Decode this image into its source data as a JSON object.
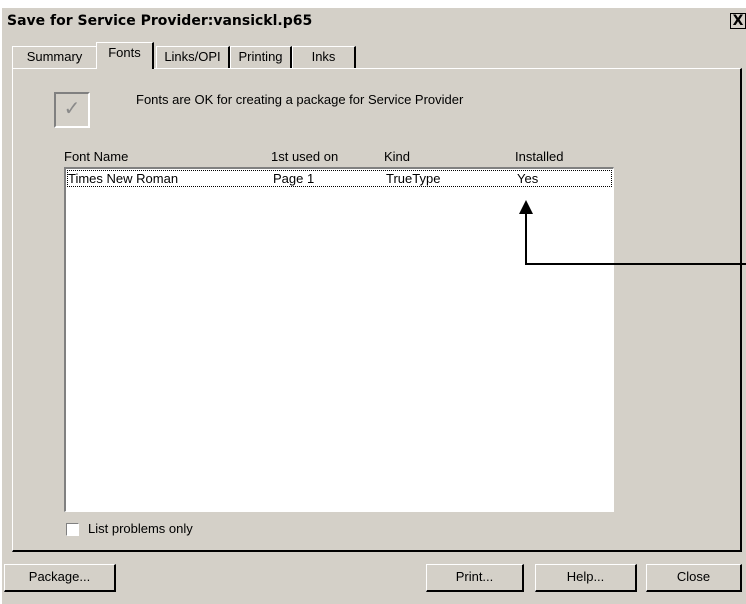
{
  "window": {
    "title": "Save for Service Provider:vansickl.p65",
    "close_label": "X"
  },
  "tabs": [
    {
      "label": "Summary",
      "active": false
    },
    {
      "label": "Fonts",
      "active": true
    },
    {
      "label": "Links/OPI",
      "active": false
    },
    {
      "label": "Printing",
      "active": false
    },
    {
      "label": "Inks",
      "active": false
    }
  ],
  "status": {
    "message": "Fonts are OK for creating a package for Service Provider",
    "checked": true
  },
  "font_table": {
    "columns": [
      "Font Name",
      "1st used on",
      "Kind",
      "Installed"
    ],
    "rows": [
      [
        "Times New Roman",
        "Page 1",
        "TrueType",
        "Yes"
      ]
    ]
  },
  "options": {
    "list_problems_only_label": "List problems only",
    "list_problems_only_checked": false
  },
  "buttons": {
    "package": "Package...",
    "print": "Print...",
    "help": "Help...",
    "close": "Close"
  }
}
